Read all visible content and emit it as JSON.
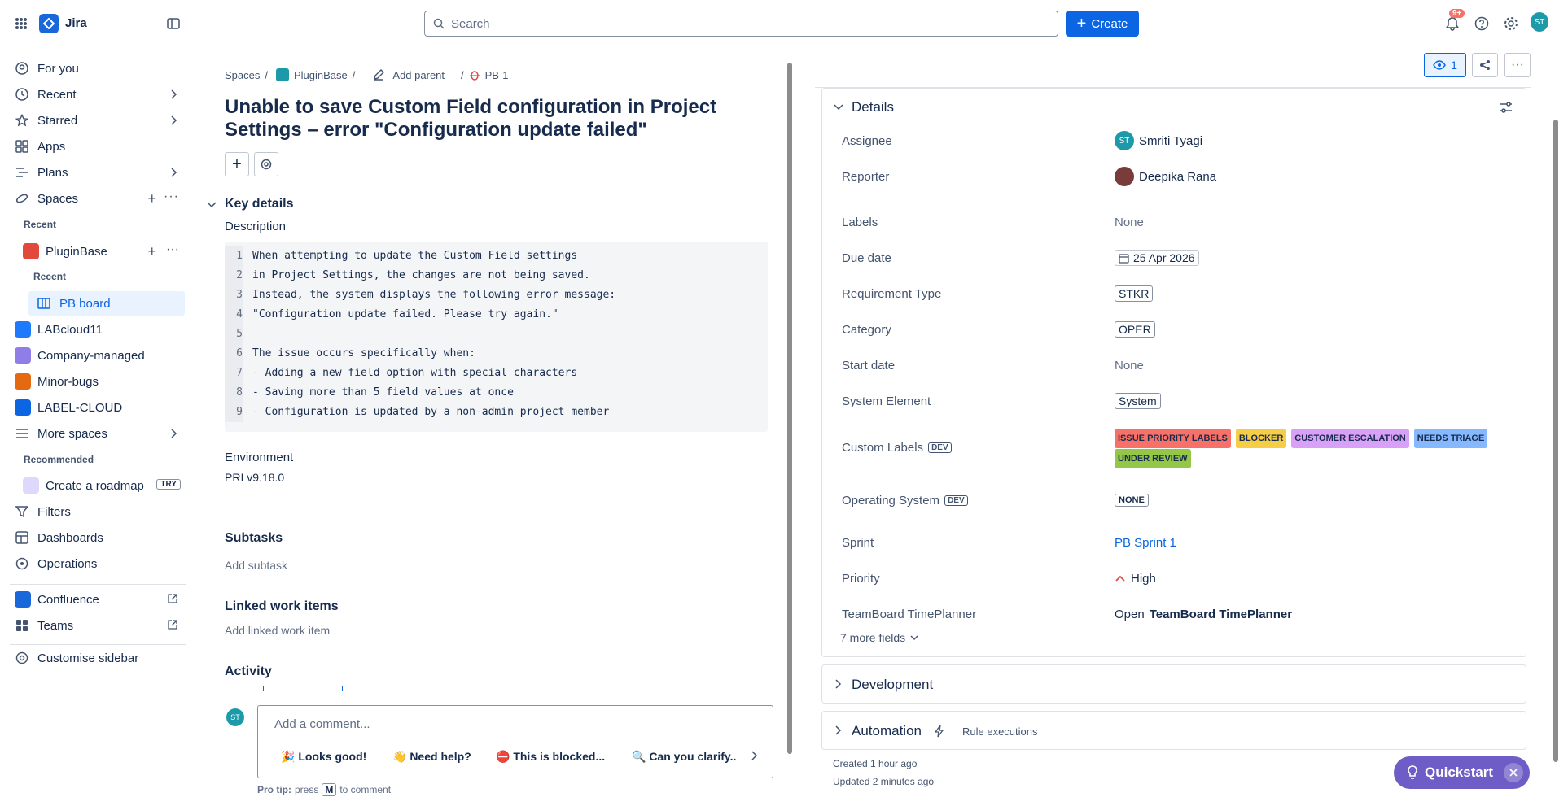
{
  "app": {
    "brand": "Jira"
  },
  "search": {
    "placeholder": "Search"
  },
  "create": {
    "label": "Create"
  },
  "notifications": {
    "badge": "9+"
  },
  "user": {
    "initials": "ST"
  },
  "sidebar": {
    "items": [
      {
        "label": "For you"
      },
      {
        "label": "Recent"
      },
      {
        "label": "Starred"
      },
      {
        "label": "Apps"
      },
      {
        "label": "Plans"
      },
      {
        "label": "Spaces"
      }
    ],
    "recent_label": "Recent",
    "project": "PluginBase",
    "project_recent_label": "Recent",
    "board": "PB board",
    "spaces": [
      "LABcloud11",
      "Company-managed",
      "Minor-bugs",
      "LABEL-CLOUD"
    ],
    "more_spaces": "More spaces",
    "recommended_label": "Recommended",
    "roadmap": "Create a roadmap",
    "try_badge": "TRY",
    "bottom": [
      "Filters",
      "Dashboards",
      "Operations"
    ],
    "confluence": "Confluence",
    "teams": "Teams",
    "customise": "Customise sidebar"
  },
  "breadcrumb": {
    "spaces": "Spaces",
    "project": "PluginBase",
    "add_parent": "Add parent",
    "key": "PB-1"
  },
  "issue": {
    "title": "Unable to save Custom Field configuration in Project Settings – error \"Configuration update failed\"",
    "key_details": "Key details",
    "description_label": "Description",
    "description_lines": [
      "When attempting to update the Custom Field settings",
      "in Project Settings, the changes are not being saved.",
      "Instead, the system displays the following error message:",
      "\"Configuration update failed. Please try again.\"",
      "",
      "The issue occurs specifically when:",
      "- Adding a new field option with special characters",
      "- Saving more than 5 field values at once",
      "- Configuration is updated by a non-admin project member"
    ],
    "environment_label": "Environment",
    "environment": "PRI v9.18.0",
    "subtasks": "Subtasks",
    "add_subtask": "Add subtask",
    "linked": "Linked work items",
    "add_linked": "Add linked work item",
    "activity": "Activity",
    "comment_placeholder": "Add a comment...",
    "quick_comments": [
      "🎉 Looks good!",
      "👋 Need help?",
      "⛔ This is blocked...",
      "🔍 Can you clarify.."
    ],
    "pro_tip_prefix": "Pro tip:",
    "pro_tip_press": "press",
    "pro_tip_key": "M",
    "pro_tip_suffix": "to comment"
  },
  "watchers": "1",
  "details": {
    "title": "Details",
    "assignee_label": "Assignee",
    "assignee": "Smriti Tyagi",
    "assignee_initials": "ST",
    "reporter_label": "Reporter",
    "reporter": "Deepika Rana",
    "labels_label": "Labels",
    "labels": "None",
    "due_label": "Due date",
    "due": "25 Apr 2026",
    "req_label": "Requirement Type",
    "req": "STKR",
    "cat_label": "Category",
    "cat": "OPER",
    "start_label": "Start date",
    "start": "None",
    "sys_label": "System Element",
    "sys": "System",
    "custom_label": "Custom Labels",
    "dev": "DEV",
    "custom_tags": [
      {
        "text": "ISSUE PRIORITY LABELS",
        "color": "#f87168"
      },
      {
        "text": "BLOCKER",
        "color": "#f5cd47"
      },
      {
        "text": "CUSTOMER ESCALATION",
        "color": "#d8a0f7"
      },
      {
        "text": "NEEDS TRIAGE",
        "color": "#85b8ff"
      },
      {
        "text": "UNDER REVIEW",
        "color": "#94c748"
      }
    ],
    "os_label": "Operating System",
    "os": "NONE",
    "sprint_label": "Sprint",
    "sprint": "PB Sprint 1",
    "priority_label": "Priority",
    "priority": "High",
    "tb_label": "TeamBoard TimePlanner",
    "tb_open": "Open",
    "tb_name": "TeamBoard TimePlanner",
    "more": "7 more fields"
  },
  "development": "Development",
  "automation": {
    "title": "Automation",
    "rules": "Rule executions"
  },
  "meta": {
    "created": "Created 1 hour ago",
    "updated": "Updated 2 minutes ago"
  },
  "quickstart": "Quickstart"
}
